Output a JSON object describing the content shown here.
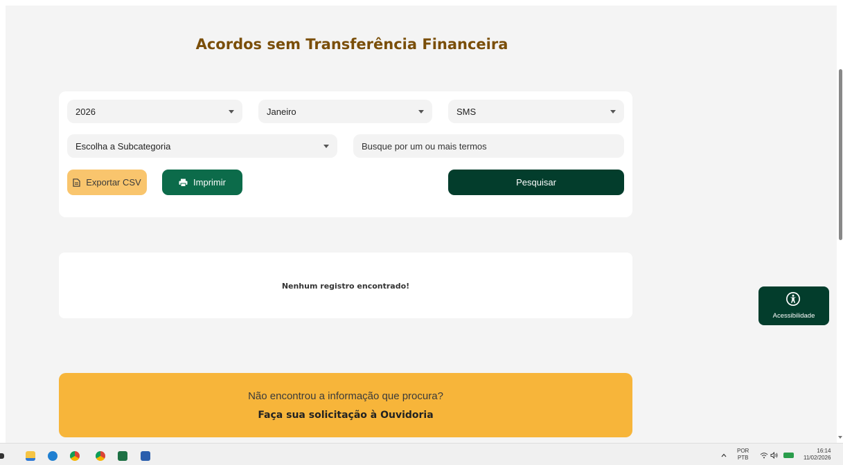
{
  "page": {
    "title": "Acordos sem Transferência Financeira"
  },
  "filters": {
    "year": "2026",
    "month": "Janeiro",
    "category": "SMS",
    "subcategory": "Escolha a Subcategoria",
    "search_placeholder": "Busque por um ou mais termos"
  },
  "actions": {
    "export_csv": "Exportar CSV",
    "print": "Imprimir",
    "search": "Pesquisar"
  },
  "results": {
    "empty_message": "Nenhum registro encontrado!"
  },
  "ouvidoria": {
    "question": "Não encontrou a informação que procura?",
    "cta": "Faça sua solicitação à Ouvidoria"
  },
  "accessibility": {
    "label": "Acessibilidade"
  },
  "taskbar": {
    "lang_top": "POR",
    "lang_bottom": "PTB",
    "time": "16:14",
    "date": "11/02/2026",
    "apps": [
      "file-explorer-icon",
      "edge-icon",
      "chrome-icon",
      "chrome-profile-icon",
      "excel-icon",
      "word-icon"
    ]
  },
  "colors": {
    "title": "#7a4e09",
    "primary_dark": "#033d2c",
    "primary": "#0c6b4a",
    "csv_button": "#f9c56d",
    "ouvidoria_banner": "#f7b53a"
  }
}
